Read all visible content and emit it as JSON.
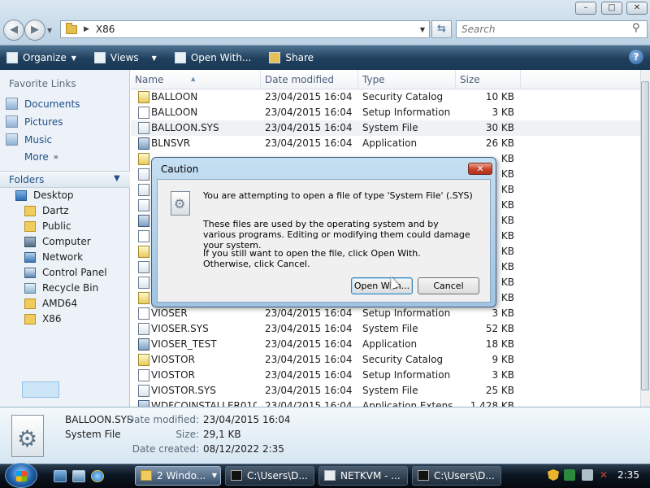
{
  "window": {
    "controls": [
      "–",
      "□",
      "✕"
    ],
    "address_path": "X86",
    "search_placeholder": "Search"
  },
  "toolbar": {
    "organize": "Organize",
    "views": "Views",
    "open_with": "Open With...",
    "share": "Share"
  },
  "sidebar": {
    "favorites_title": "Favorite Links",
    "favorites": [
      "Documents",
      "Pictures",
      "Music"
    ],
    "more": "More",
    "folders_title": "Folders",
    "tree": [
      {
        "label": "Desktop",
        "icon": "desktop-icon"
      },
      {
        "label": "Dartz",
        "icon": "folder-icon"
      },
      {
        "label": "Public",
        "icon": "folder-icon"
      },
      {
        "label": "Computer",
        "icon": "computer-icon"
      },
      {
        "label": "Network",
        "icon": "network-icon"
      },
      {
        "label": "Control Panel",
        "icon": "control-panel-icon"
      },
      {
        "label": "Recycle Bin",
        "icon": "recycle-bin-icon"
      },
      {
        "label": "AMD64",
        "icon": "folder-icon"
      },
      {
        "label": "X86",
        "icon": "folder-icon",
        "selected": true
      }
    ]
  },
  "columns": [
    "Name",
    "Date modified",
    "Type",
    "Size"
  ],
  "files": [
    {
      "name": "BALLOON",
      "date": "23/04/2015 16:04",
      "type": "Security Catalog",
      "size": "10 KB",
      "icon": "cat"
    },
    {
      "name": "BALLOON",
      "date": "23/04/2015 16:04",
      "type": "Setup Information",
      "size": "3 KB",
      "icon": "inf"
    },
    {
      "name": "BALLOON.SYS",
      "date": "23/04/2015 16:04",
      "type": "System File",
      "size": "30 KB",
      "icon": "sys",
      "selected": true
    },
    {
      "name": "BLNSVR",
      "date": "23/04/2015 16:04",
      "type": "Application",
      "size": "26 KB",
      "icon": "app"
    },
    {
      "name": "",
      "date": "",
      "type": "",
      "size": "KB",
      "icon": "cat"
    },
    {
      "name": "",
      "date": "",
      "type": "",
      "size": "KB",
      "icon": "sys"
    },
    {
      "name": "",
      "date": "",
      "type": "",
      "size": "KB",
      "icon": "sys"
    },
    {
      "name": "",
      "date": "",
      "type": "",
      "size": "KB",
      "icon": "sys"
    },
    {
      "name": "",
      "date": "",
      "type": "",
      "size": "KB",
      "icon": "app"
    },
    {
      "name": "",
      "date": "",
      "type": "",
      "size": "KB",
      "icon": "inf"
    },
    {
      "name": "",
      "date": "",
      "type": "",
      "size": "KB",
      "icon": "cat"
    },
    {
      "name": "",
      "date": "",
      "type": "",
      "size": "KB",
      "icon": "sys"
    },
    {
      "name": "",
      "date": "",
      "type": "",
      "size": "KB",
      "icon": "sys"
    },
    {
      "name": "",
      "date": "",
      "type": "",
      "size": "KB",
      "icon": "cat"
    },
    {
      "name": "VIOSER",
      "date": "23/04/2015 16:04",
      "type": "Setup Information",
      "size": "3 KB",
      "icon": "inf"
    },
    {
      "name": "VIOSER.SYS",
      "date": "23/04/2015 16:04",
      "type": "System File",
      "size": "52 KB",
      "icon": "sys"
    },
    {
      "name": "VIOSER_TEST",
      "date": "23/04/2015 16:04",
      "type": "Application",
      "size": "18 KB",
      "icon": "app"
    },
    {
      "name": "VIOSTOR",
      "date": "23/04/2015 16:04",
      "type": "Security Catalog",
      "size": "9 KB",
      "icon": "cat"
    },
    {
      "name": "VIOSTOR",
      "date": "23/04/2015 16:04",
      "type": "Setup Information",
      "size": "3 KB",
      "icon": "inf"
    },
    {
      "name": "VIOSTOR.SYS",
      "date": "23/04/2015 16:04",
      "type": "System File",
      "size": "25 KB",
      "icon": "sys"
    },
    {
      "name": "WDFCOINSTALLER010...",
      "date": "23/04/2015 16:04",
      "type": "Application Extens...",
      "size": "1,428 KB",
      "icon": "app"
    }
  ],
  "dialog": {
    "title": "Caution",
    "close": "✕",
    "line1": "You are attempting to open a file of type 'System File' (.SYS)",
    "line2": "These files are used by the operating system and by various programs. Editing or modifying them could damage your system.",
    "line3": "If you still want to open the file, click Open With. Otherwise, click Cancel.",
    "open_with": "Open With...",
    "cancel": "Cancel"
  },
  "details": {
    "filename": "BALLOON.SYS",
    "filetype": "System File",
    "date_modified_label": "Date modified:",
    "date_modified": "23/04/2015 16:04",
    "size_label": "Size:",
    "size": "29,1 KB",
    "date_created_label": "Date created:",
    "date_created": "08/12/2022 2:35"
  },
  "taskbar": {
    "tasks": [
      "2 Windo...",
      "C:\\Users\\D...",
      "NETKVM - ...",
      "C:\\Users\\D..."
    ],
    "clock": "2:35"
  }
}
